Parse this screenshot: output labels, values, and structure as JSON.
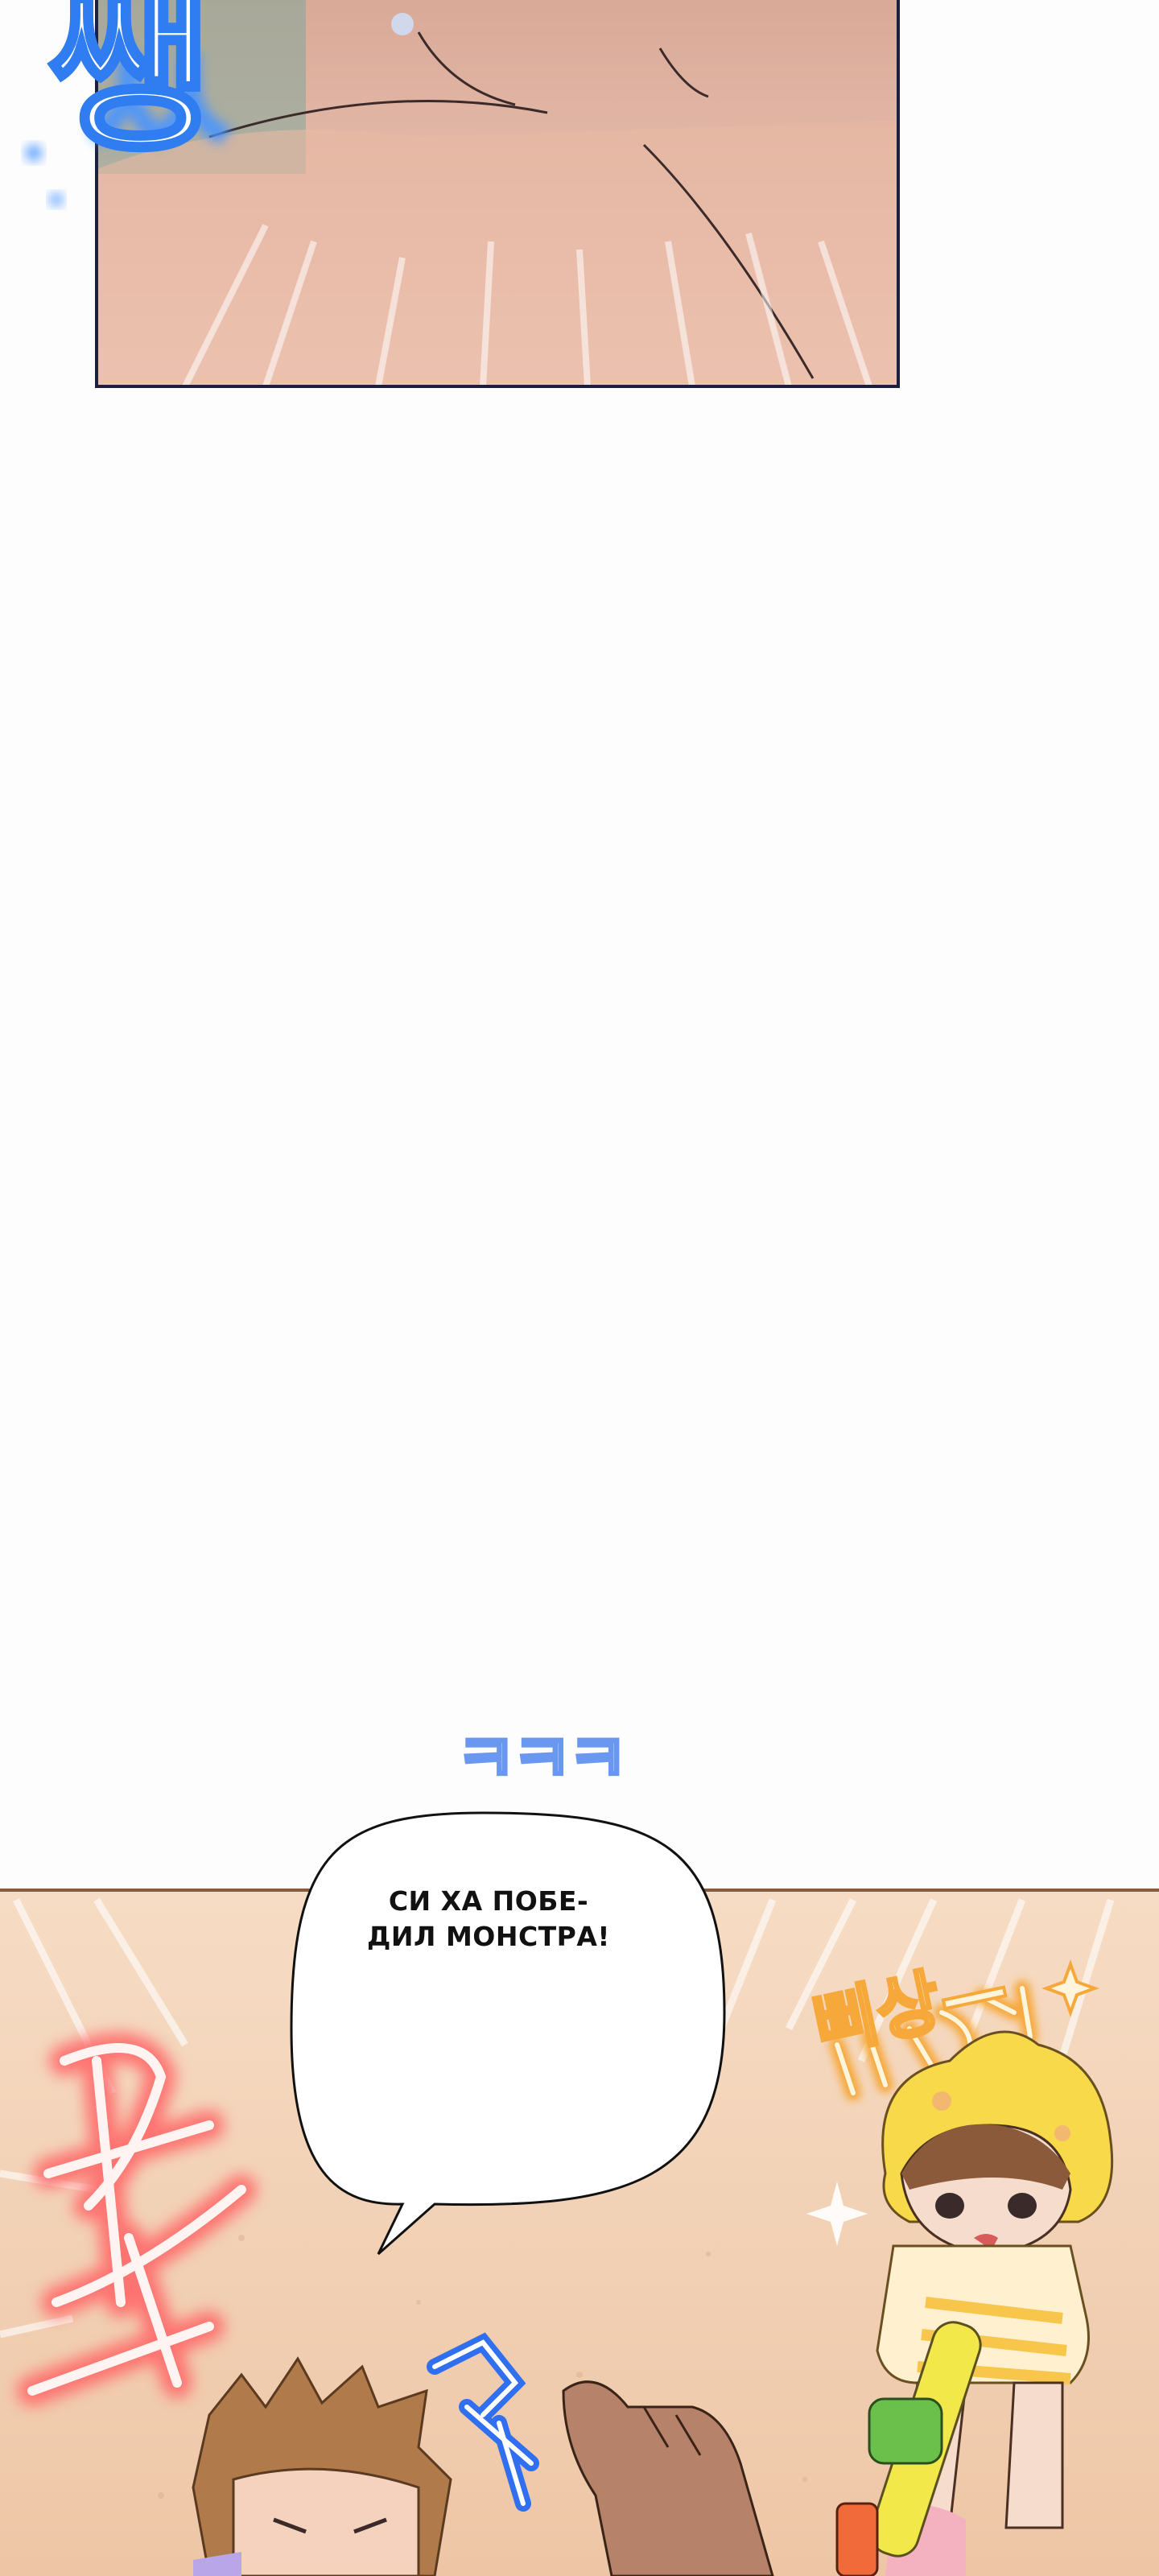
{
  "page": {
    "background_color": "#fdfdfd"
  },
  "panel_top": {
    "sfx": "쌩"
  },
  "panel_bottom": {
    "sfx_laugh_top": "ㅋㅋㅋ",
    "speech_line_1": "СИ ХА ПОБЕ-",
    "speech_line_2": "ДИЛ МОНСТРА!",
    "sfx_left": "ㅋㅋ",
    "sfx_right": "삐상—",
    "sfx_small": "ㅋㅋ"
  },
  "colors": {
    "sand": "#f2cfae",
    "skin": "#ecc0a8",
    "sfx_blue": "#3a7ef0",
    "sfx_red": "#f04a4a",
    "sfx_orange": "#f6b43a",
    "duck_yellow": "#f7d94a"
  }
}
